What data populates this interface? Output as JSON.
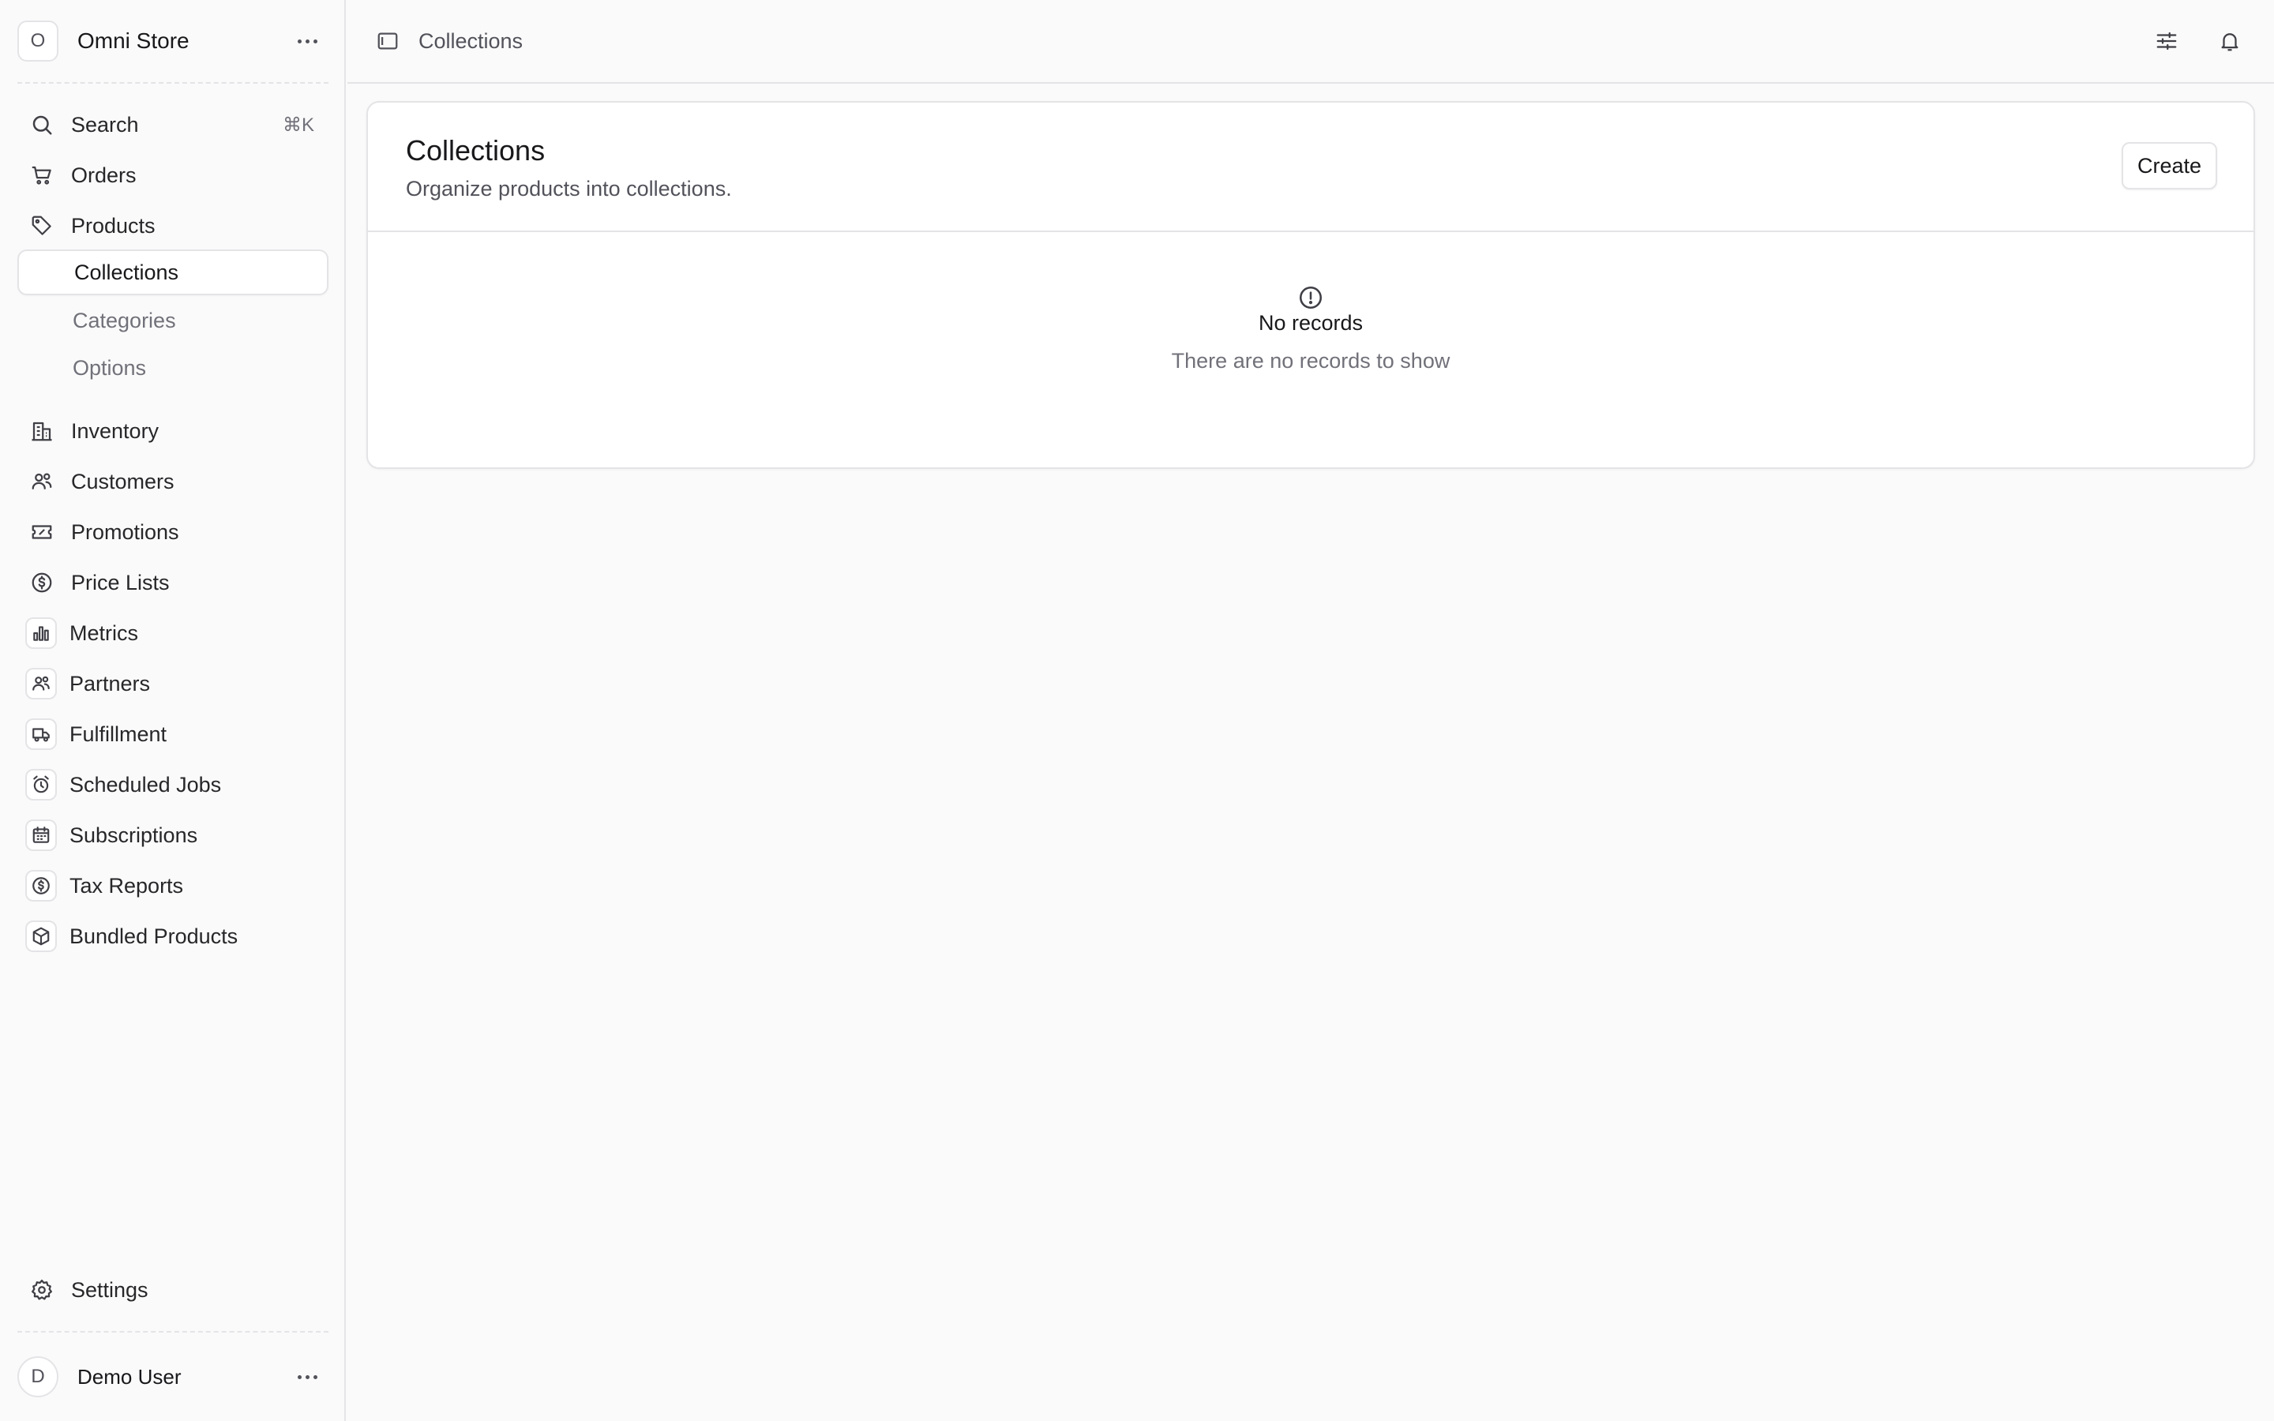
{
  "sidebar": {
    "store": {
      "initial": "O",
      "name": "Omni Store"
    },
    "search": {
      "label": "Search",
      "shortcut": "⌘K"
    },
    "items": [
      {
        "label": "Orders",
        "icon": "cart-icon"
      },
      {
        "label": "Products",
        "icon": "tag-icon"
      }
    ],
    "product_sub": [
      {
        "label": "Collections",
        "active": true
      },
      {
        "label": "Categories"
      },
      {
        "label": "Options"
      }
    ],
    "items_main": [
      {
        "label": "Inventory",
        "icon": "building-icon"
      },
      {
        "label": "Customers",
        "icon": "users-icon"
      },
      {
        "label": "Promotions",
        "icon": "ticket-icon"
      },
      {
        "label": "Price Lists",
        "icon": "currency-icon"
      }
    ],
    "extensions": [
      {
        "label": "Metrics",
        "icon": "bar-chart-icon"
      },
      {
        "label": "Partners",
        "icon": "users-icon"
      },
      {
        "label": "Fulfillment",
        "icon": "truck-icon"
      },
      {
        "label": "Scheduled Jobs",
        "icon": "alarm-icon"
      },
      {
        "label": "Subscriptions",
        "icon": "calendar-icon"
      },
      {
        "label": "Tax Reports",
        "icon": "currency-icon"
      },
      {
        "label": "Bundled Products",
        "icon": "box-icon"
      }
    ],
    "settings": {
      "label": "Settings"
    },
    "user": {
      "initial": "D",
      "name": "Demo User"
    }
  },
  "topbar": {
    "breadcrumb": "Collections"
  },
  "main": {
    "title": "Collections",
    "subtitle": "Organize products into collections.",
    "create_label": "Create",
    "empty_title": "No records",
    "empty_text": "There are no records to show"
  }
}
